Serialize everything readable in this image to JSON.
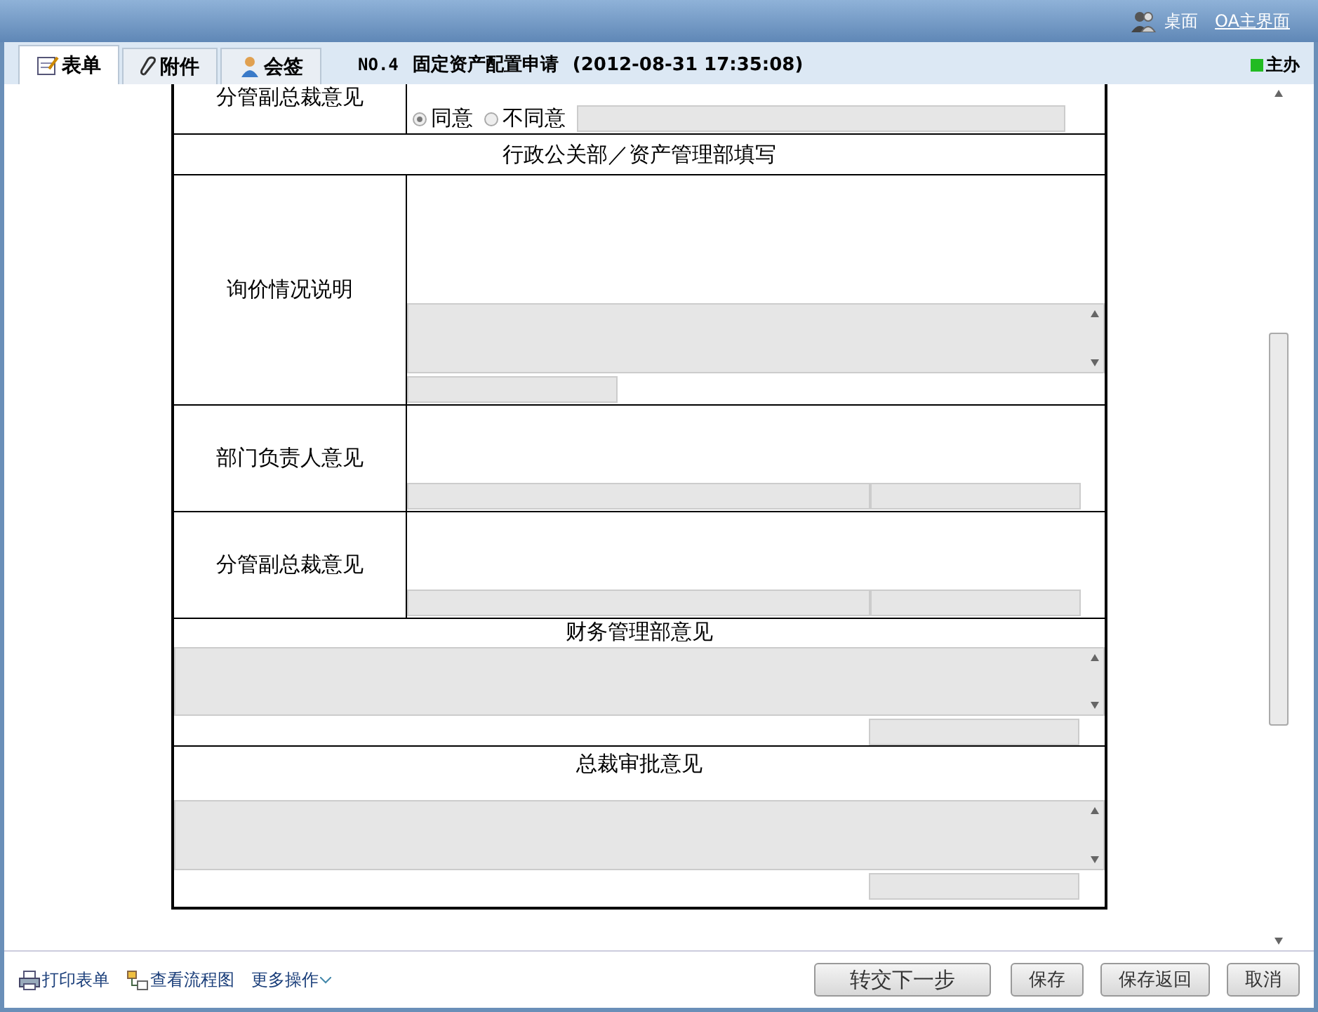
{
  "top_links": [
    {
      "kind": "desktop",
      "label": "桌面"
    },
    {
      "kind": "link",
      "label": "OA主界面"
    }
  ],
  "tabs": [
    {
      "label": "表单",
      "selected": true
    },
    {
      "label": "附件",
      "selected": false
    },
    {
      "label": "会签",
      "selected": false
    }
  ],
  "document": {
    "number": "NO.4",
    "title": "固定资产配置申请",
    "timestamp": "(2012-08-31 17:35:08)"
  },
  "role": {
    "label": "主办",
    "color": "#22bb22"
  },
  "form_rows": [
    {
      "kind": "approval",
      "label": "分管副总裁意见",
      "options": [
        {
          "label": "同意",
          "selected": true
        },
        {
          "label": "不同意",
          "selected": false
        }
      ]
    },
    {
      "kind": "section",
      "title": "行政公关部／资产管理部填写"
    },
    {
      "kind": "textarea",
      "label": "询价情况说明"
    },
    {
      "kind": "opinion",
      "label": "部门负责人意见"
    },
    {
      "kind": "opinion",
      "label": "分管副总裁意见"
    },
    {
      "kind": "wide",
      "title": "财务管理部意见"
    },
    {
      "kind": "wide",
      "title": "总裁审批意见"
    }
  ],
  "footer_links": [
    {
      "label": "打印表单"
    },
    {
      "label": "查看流程图"
    },
    {
      "label": "更多操作"
    }
  ],
  "buttons": [
    {
      "label": "转交下一步",
      "kind": "primary"
    },
    {
      "label": "保存",
      "kind": "normal"
    },
    {
      "label": "保存返回",
      "kind": "normal"
    },
    {
      "label": "取消",
      "kind": "normal"
    }
  ]
}
